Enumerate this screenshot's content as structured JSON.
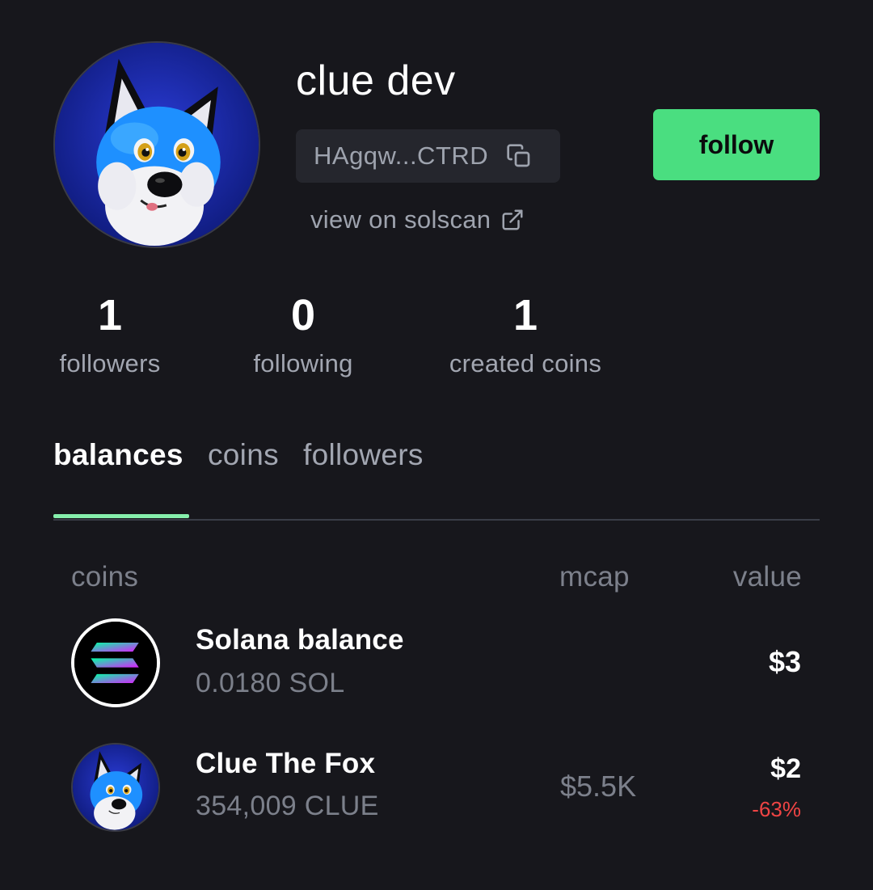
{
  "profile": {
    "username": "clue dev",
    "address_short": "HAgqw...CTRD",
    "solscan_link": "view on solscan",
    "follow_label": "follow",
    "avatar_icon": "fox-avatar"
  },
  "stats": [
    {
      "value": "1",
      "label": "followers"
    },
    {
      "value": "0",
      "label": "following"
    },
    {
      "value": "1",
      "label": "created coins"
    }
  ],
  "tabs": [
    {
      "label": "balances",
      "active": true
    },
    {
      "label": "coins",
      "active": false
    },
    {
      "label": "followers",
      "active": false
    }
  ],
  "table": {
    "headers": {
      "coins": "coins",
      "mcap": "mcap",
      "value": "value"
    },
    "rows": [
      {
        "icon": "solana-logo",
        "name": "Solana balance",
        "amount": "0.0180 SOL",
        "mcap": "",
        "value": "$3",
        "change": ""
      },
      {
        "icon": "fox-avatar",
        "name": "Clue The Fox",
        "amount": "354,009 CLUE",
        "mcap": "$5.5K",
        "value": "$2",
        "change": "-63%"
      }
    ]
  },
  "colors": {
    "background": "#17171c",
    "accent_green": "#4ade80",
    "tab_indicator": "#86efac",
    "negative": "#ef4444"
  }
}
